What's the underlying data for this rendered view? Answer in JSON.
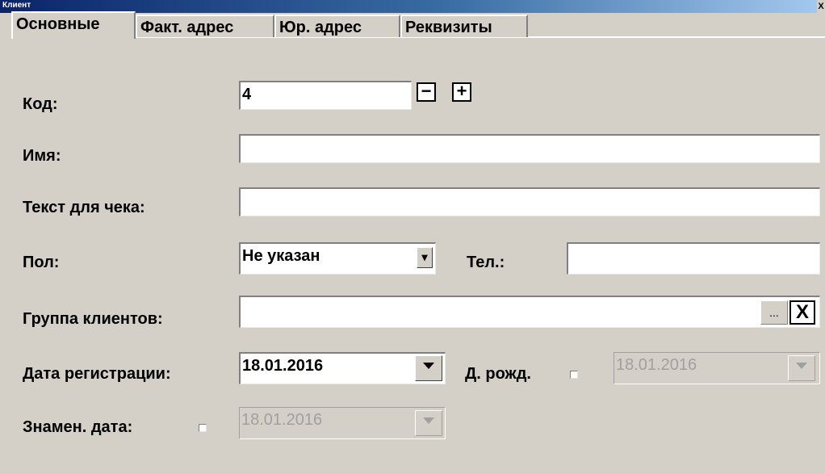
{
  "window": {
    "title": "Клиент",
    "close_glyph": "X"
  },
  "tabs": [
    {
      "label": "Основные",
      "active": true
    },
    {
      "label": "Факт. адрес",
      "active": false
    },
    {
      "label": "Юр. адрес",
      "active": false
    },
    {
      "label": "Реквизиты",
      "active": false
    }
  ],
  "form": {
    "code": {
      "label": "Код:",
      "value": "4",
      "minus": "−",
      "plus": "+"
    },
    "name": {
      "label": "Имя:",
      "value": ""
    },
    "receipt_text": {
      "label": "Текст для чека:",
      "value": ""
    },
    "gender": {
      "label": "Пол:",
      "value": "Не указан",
      "arrow": "▾"
    },
    "phone": {
      "label": "Тел.:",
      "value": ""
    },
    "client_group": {
      "label": "Группа клиентов:",
      "value": "",
      "browse": "...",
      "clear": "X"
    },
    "reg_date": {
      "label": "Дата регистрации:",
      "value": "18.01.2016"
    },
    "birth_date": {
      "label": "Д. рожд.",
      "value": "18.01.2016",
      "checked": false
    },
    "memorable_date": {
      "label": "Знамен. дата:",
      "value": "18.01.2016",
      "checked": false
    }
  }
}
